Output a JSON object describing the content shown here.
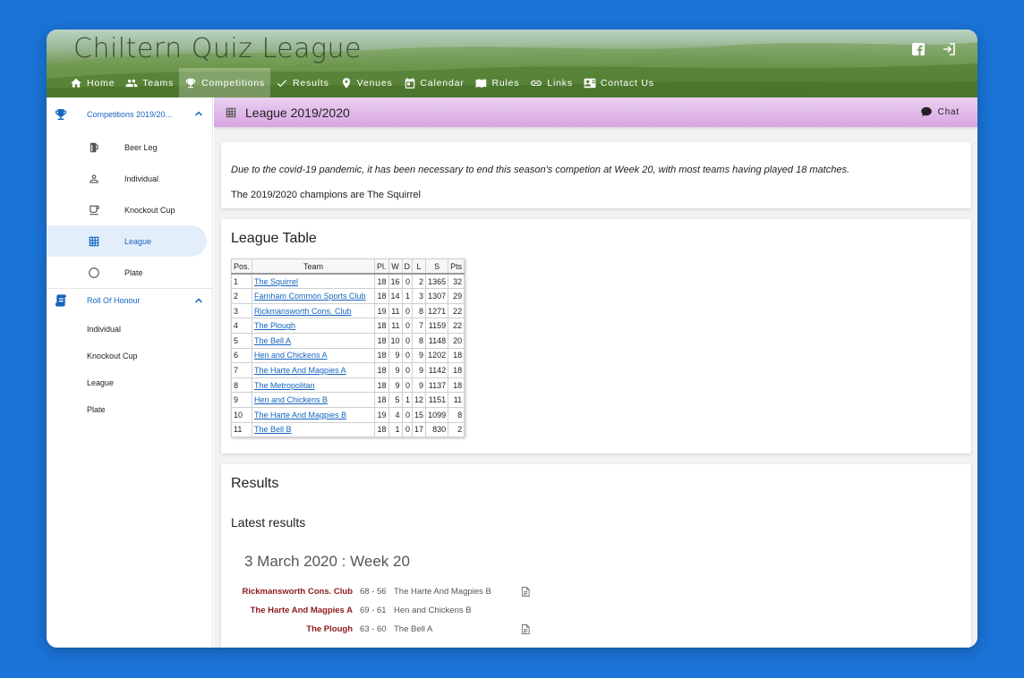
{
  "header": {
    "site_title": "Chiltern Quiz League",
    "nav": [
      {
        "label": "Home",
        "icon": "home-icon"
      },
      {
        "label": "Teams",
        "icon": "people-icon"
      },
      {
        "label": "Competitions",
        "icon": "trophy-icon",
        "active": true
      },
      {
        "label": "Results",
        "icon": "check-icon"
      },
      {
        "label": "Venues",
        "icon": "location-pin-icon"
      },
      {
        "label": "Calendar",
        "icon": "calendar-icon"
      },
      {
        "label": "Rules",
        "icon": "book-icon"
      },
      {
        "label": "Links",
        "icon": "link-icon"
      },
      {
        "label": "Contact Us",
        "icon": "contact-card-icon"
      }
    ]
  },
  "sidebar": {
    "competitions_label": "Competitions 2019/20...",
    "competitions_items": [
      {
        "label": "Beer Leg",
        "icon": "beer-icon"
      },
      {
        "label": "Individual",
        "icon": "person-icon"
      },
      {
        "label": "Knockout Cup",
        "icon": "cup-icon"
      },
      {
        "label": "League",
        "icon": "table-grid-icon",
        "active": true
      },
      {
        "label": "Plate",
        "icon": "circle-icon"
      }
    ],
    "roll_label": "Roll Of Honour",
    "roll_items": [
      "Individual",
      "Knockout Cup",
      "League",
      "Plate"
    ]
  },
  "page": {
    "title": "League 2019/2020",
    "chat_label": "Chat",
    "notice": "Due to the covid-19 pandemic, it has been necessary to end this season's competion at Week 20, with most teams having played 18 matches.",
    "champions": "The 2019/2020 champions are The Squirrel"
  },
  "league_table": {
    "heading": "League Table",
    "columns": [
      "Pos.",
      "Team",
      "Pl.",
      "W",
      "D",
      "L",
      "S",
      "Pts"
    ],
    "rows": [
      [
        "1",
        "The Squirrel",
        "18",
        "16",
        "0",
        "2",
        "1365",
        "32"
      ],
      [
        "2",
        "Farnham Common Sports Club",
        "18",
        "14",
        "1",
        "3",
        "1307",
        "29"
      ],
      [
        "3",
        "Rickmansworth Cons. Club",
        "19",
        "11",
        "0",
        "8",
        "1271",
        "22"
      ],
      [
        "4",
        "The Plough",
        "18",
        "11",
        "0",
        "7",
        "1159",
        "22"
      ],
      [
        "5",
        "The Bell A",
        "18",
        "10",
        "0",
        "8",
        "1148",
        "20"
      ],
      [
        "6",
        "Hen and Chickens A",
        "18",
        "9",
        "0",
        "9",
        "1202",
        "18"
      ],
      [
        "7",
        "The Harte And Magpies A",
        "18",
        "9",
        "0",
        "9",
        "1142",
        "18"
      ],
      [
        "8",
        "The Metropolitan",
        "18",
        "9",
        "0",
        "9",
        "1137",
        "18"
      ],
      [
        "9",
        "Hen and Chickens B",
        "18",
        "5",
        "1",
        "12",
        "1151",
        "11"
      ],
      [
        "10",
        "The Harte And Magpies B",
        "19",
        "4",
        "0",
        "15",
        "1099",
        "8"
      ],
      [
        "11",
        "The Bell B",
        "18",
        "1",
        "0",
        "17",
        "830",
        "2"
      ]
    ]
  },
  "results": {
    "heading": "Results",
    "latest_heading": "Latest results",
    "week_title": "3 March 2020 : Week 20",
    "matches": [
      {
        "home": "Rickmansworth Cons. Club",
        "score": "68 - 56",
        "away": "The Harte And Magpies B",
        "has_doc": true
      },
      {
        "home": "The Harte And Magpies A",
        "score": "69 - 61",
        "away": "Hen and Chickens B",
        "has_doc": false
      },
      {
        "home": "The Plough",
        "score": "63 - 60",
        "away": "The Bell A",
        "has_doc": true
      }
    ]
  }
}
